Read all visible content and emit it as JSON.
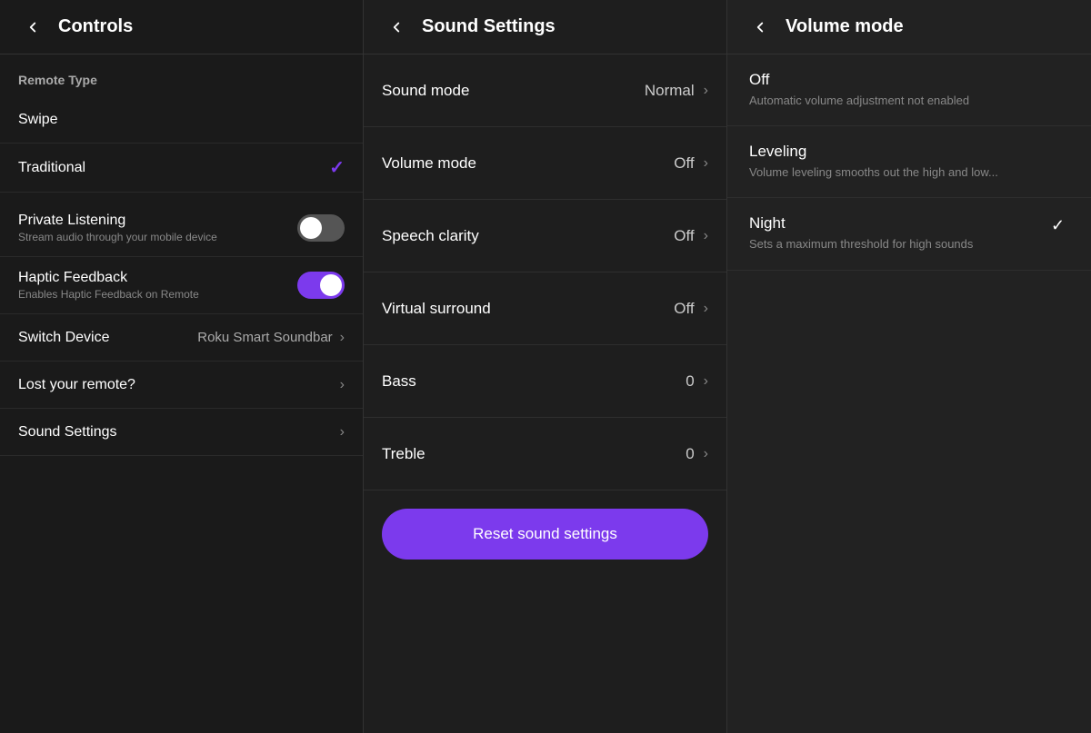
{
  "panels": {
    "controls": {
      "title": "Controls",
      "sections": {
        "remoteType": {
          "label": "Remote Type",
          "options": [
            {
              "id": "swipe",
              "label": "Swipe",
              "selected": false
            },
            {
              "id": "traditional",
              "label": "Traditional",
              "selected": true
            }
          ]
        },
        "privateListening": {
          "label": "Private Listening",
          "sublabel": "Stream audio through your mobile device",
          "enabled": false
        },
        "hapticFeedback": {
          "label": "Haptic Feedback",
          "sublabel": "Enables Haptic Feedback on Remote",
          "enabled": true
        },
        "switchDevice": {
          "label": "Switch Device",
          "value": "Roku Smart Soundbar"
        },
        "lostRemote": {
          "label": "Lost your remote?"
        },
        "soundSettings": {
          "label": "Sound Settings"
        }
      }
    },
    "soundSettings": {
      "title": "Sound Settings",
      "items": [
        {
          "id": "sound-mode",
          "label": "Sound mode",
          "value": "Normal"
        },
        {
          "id": "volume-mode",
          "label": "Volume mode",
          "value": "Off"
        },
        {
          "id": "speech-clarity",
          "label": "Speech clarity",
          "value": "Off"
        },
        {
          "id": "virtual-surround",
          "label": "Virtual surround",
          "value": "Off"
        },
        {
          "id": "bass",
          "label": "Bass",
          "value": "0"
        },
        {
          "id": "treble",
          "label": "Treble",
          "value": "0"
        }
      ],
      "resetButton": "Reset sound settings"
    },
    "volumeMode": {
      "title": "Volume mode",
      "options": [
        {
          "id": "off",
          "label": "Off",
          "description": "Automatic volume adjustment not enabled",
          "selected": true
        },
        {
          "id": "leveling",
          "label": "Leveling",
          "description": "Volume leveling smooths out the high and low...",
          "selected": false
        },
        {
          "id": "night",
          "label": "Night",
          "description": "Sets a maximum threshold for high sounds",
          "selected": false
        }
      ]
    }
  },
  "icons": {
    "back": "‹",
    "chevron": "›",
    "check": "✓"
  }
}
